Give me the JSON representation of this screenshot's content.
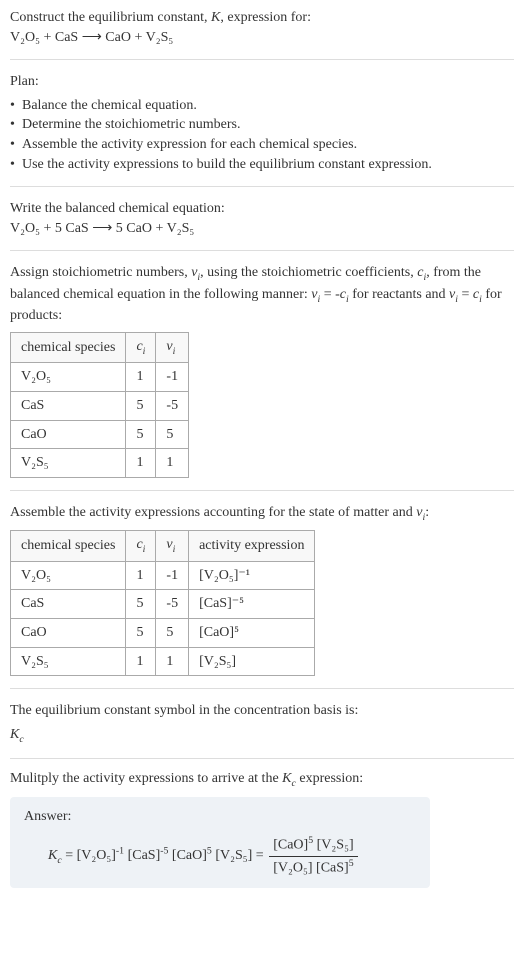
{
  "intro": {
    "construct_line": "Construct the equilibrium constant, K, expression for:",
    "reaction_unbalanced": "V₂O₅ + CaS ⟶ CaO + V₂S₅"
  },
  "plan": {
    "heading": "Plan:",
    "items": [
      "Balance the chemical equation.",
      "Determine the stoichiometric numbers.",
      "Assemble the activity expression for each chemical species.",
      "Use the activity expressions to build the equilibrium constant expression."
    ]
  },
  "balanced": {
    "heading": "Write the balanced chemical equation:",
    "equation": "V₂O₅ + 5 CaS ⟶ 5 CaO + V₂S₅"
  },
  "stoich": {
    "intro_a": "Assign stoichiometric numbers, νᵢ, using the stoichiometric coefficients, cᵢ, from the balanced chemical equation in the following manner: νᵢ = -cᵢ for reactants and νᵢ = cᵢ for products:",
    "headers": {
      "species": "chemical species",
      "ci": "cᵢ",
      "vi": "νᵢ"
    },
    "rows": [
      {
        "species": "V₂O₅",
        "ci": "1",
        "vi": "-1"
      },
      {
        "species": "CaS",
        "ci": "5",
        "vi": "-5"
      },
      {
        "species": "CaO",
        "ci": "5",
        "vi": "5"
      },
      {
        "species": "V₂S₅",
        "ci": "1",
        "vi": "1"
      }
    ]
  },
  "activity": {
    "intro": "Assemble the activity expressions accounting for the state of matter and νᵢ:",
    "headers": {
      "species": "chemical species",
      "ci": "cᵢ",
      "vi": "νᵢ",
      "expr": "activity expression"
    },
    "rows": [
      {
        "species": "V₂O₅",
        "ci": "1",
        "vi": "-1",
        "expr": "[V₂O₅]⁻¹"
      },
      {
        "species": "CaS",
        "ci": "5",
        "vi": "-5",
        "expr": "[CaS]⁻⁵"
      },
      {
        "species": "CaO",
        "ci": "5",
        "vi": "5",
        "expr": "[CaO]⁵"
      },
      {
        "species": "V₂S₅",
        "ci": "1",
        "vi": "1",
        "expr": "[V₂S₅]"
      }
    ]
  },
  "kc_symbol": {
    "line": "The equilibrium constant symbol in the concentration basis is:",
    "symbol": "K_c"
  },
  "multiply": {
    "line": "Mulitply the activity expressions to arrive at the K_c expression:"
  },
  "answer": {
    "label": "Answer:",
    "lhs": "K_c = [V₂O₅]⁻¹ [CaS]⁻⁵ [CaO]⁵ [V₂S₅] = ",
    "frac_num": "[CaO]⁵ [V₂S₅]",
    "frac_den": "[V₂O₅] [CaS]⁵"
  }
}
